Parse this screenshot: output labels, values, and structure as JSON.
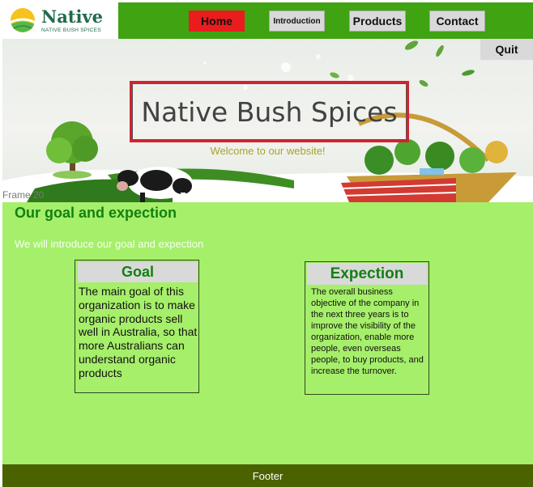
{
  "brand": {
    "name": "Native",
    "tagline": "NATIVE BUSH SPICES"
  },
  "nav": {
    "home": "Home",
    "introduction": "Introduction",
    "products": "Products",
    "contact": "Contact"
  },
  "hero": {
    "quit_label": "Quit",
    "title": "Native Bush Spices",
    "subtitle": "Welcome to our website!",
    "frame_label": "Frame 20"
  },
  "section": {
    "heading": "Our goal and expection",
    "subheading": "We will introduce our goal and expection"
  },
  "cards": [
    {
      "title": "Goal",
      "body": "The main goal of this organization is to make organic products sell well in Australia, so that more Australians can understand organic products"
    },
    {
      "title": "Expection",
      "body": "The overall business objective of the company in the next three years is to improve the visibility of the organization, enable more people, even overseas people, to buy products, and increase the turnover."
    }
  ],
  "footer": {
    "label": "Footer"
  },
  "colors": {
    "header_green": "#3fa312",
    "page_green": "#a6ef6a",
    "home_red": "#e91d1d",
    "heading_green": "#128012",
    "footer_olive": "#4b6200",
    "title_border_red": "#d4222f"
  }
}
